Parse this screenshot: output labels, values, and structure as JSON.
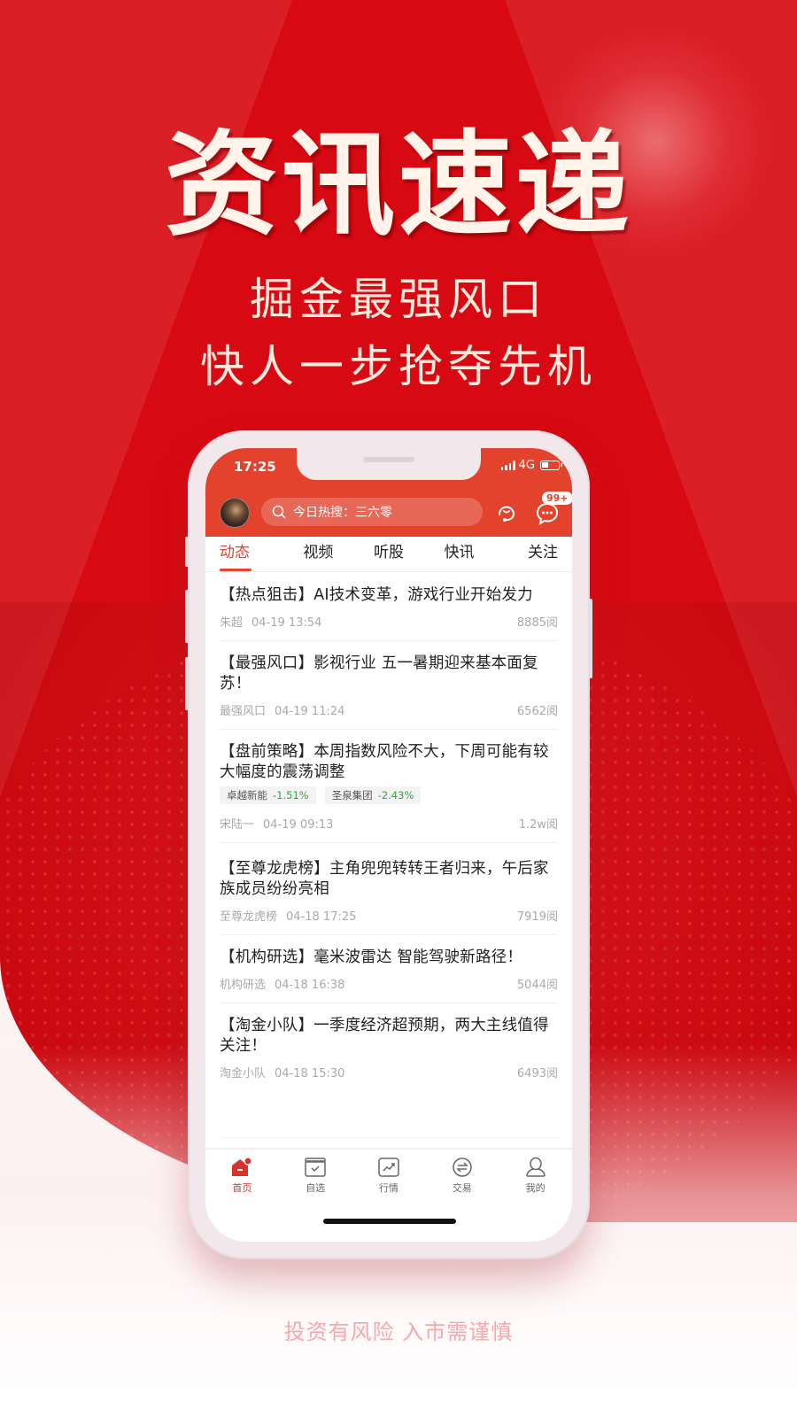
{
  "hero": {
    "title": "资讯速递",
    "subtitle_line1": "掘金最强风口",
    "subtitle_line2": "快人一步抢夺先机"
  },
  "colors": {
    "brand_red": "#d70912",
    "app_header": "#e3432d",
    "positive_change": "#3a9e4c"
  },
  "phone": {
    "status_bar": {
      "time": "17:25",
      "network": "4G",
      "signal_icon": "signal-icon",
      "battery_icon": "battery-icon"
    },
    "header": {
      "avatar_icon": "avatar",
      "search_placeholder": "今日热搜：三六零",
      "search_icon": "search-icon",
      "service_icon": "headset-icon",
      "message_icon": "chat-bubble-icon",
      "message_badge": "99+"
    },
    "tabs": [
      {
        "label": "动态",
        "active": true
      },
      {
        "label": "视频",
        "active": false
      },
      {
        "label": "听股",
        "active": false
      },
      {
        "label": "快讯",
        "active": false
      },
      {
        "label": "关注",
        "active": false
      }
    ],
    "feed": [
      {
        "title": "【热点狙击】AI技术变革，游戏行业开始发力",
        "author": "朱超",
        "time": "04-19 13:54",
        "reads": "8885阅"
      },
      {
        "title": "【最强风口】影视行业 五一暑期迎来基本面复苏！",
        "author": "最强风口",
        "time": "04-19 11:24",
        "reads": "6562阅"
      },
      {
        "title": "【盘前策略】本周指数风险不大，下周可能有较大幅度的震荡调整",
        "author": "宋陆一",
        "time": "04-19 09:13",
        "reads": "1.2w阅",
        "stocks": [
          {
            "name": "卓越新能",
            "change": "-1.51%"
          },
          {
            "name": "圣泉集团",
            "change": "-2.43%"
          }
        ]
      },
      {
        "title": "【至尊龙虎榜】主角兜兜转转王者归来，午后家族成员纷纷亮相",
        "author": "至尊龙虎榜",
        "time": "04-18 17:25",
        "reads": "7919阅"
      },
      {
        "title": "【机构研选】毫米波雷达 智能驾驶新路径！",
        "author": "机构研选",
        "time": "04-18 16:38",
        "reads": "5044阅"
      },
      {
        "title": "【淘金小队】一季度经济超预期，两大主线值得关注！",
        "author": "淘金小队",
        "time": "04-18 15:30",
        "reads": "6493阅"
      }
    ],
    "tabbar": [
      {
        "label": "首页",
        "icon": "home-icon",
        "active": true
      },
      {
        "label": "自选",
        "icon": "watchlist-icon",
        "active": false
      },
      {
        "label": "行情",
        "icon": "market-chart-icon",
        "active": false
      },
      {
        "label": "交易",
        "icon": "exchange-icon",
        "active": false
      },
      {
        "label": "我的",
        "icon": "profile-icon",
        "active": false
      }
    ]
  },
  "disclaimer": "投资有风险 入市需谨慎"
}
